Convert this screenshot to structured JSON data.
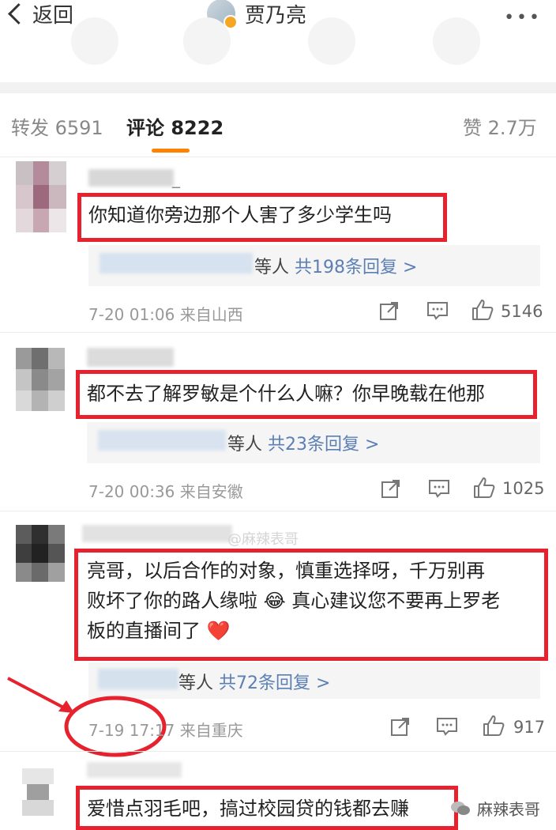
{
  "nav": {
    "back_label": "返回",
    "title": "贾乃亮",
    "more_label": "•••"
  },
  "tabs": [
    {
      "label": "转发 6591"
    },
    {
      "label": "评论 8222"
    },
    {
      "label": "赞 2.7万"
    }
  ],
  "comments": [
    {
      "username_partial": "_",
      "text": "你知道你旁边那个人害了多少学生吗",
      "reply_suffix": "等人",
      "reply_link": "共198条回复 >",
      "time": "7-20 01:06",
      "source": "来自山西",
      "likes": "5146"
    },
    {
      "text": "都不去了解罗敏是个什么人嘛？你早晚载在他那",
      "reply_suffix": "等人",
      "reply_link": "共23条回复 >",
      "time": "7-20 00:36",
      "source": "来自安徽",
      "likes": "1025"
    },
    {
      "text_lines": [
        "亮哥，以后合作的对象，慎重选择呀，千万别再",
        "败坏了你的路人缘啦 😂 真心建议您不要再上罗老",
        "板的直播间了 ❤️"
      ],
      "reply_suffix": "等人",
      "reply_link": "共72条回复 >",
      "time": "7-19 17:17",
      "source": "来自重庆",
      "likes": "917"
    },
    {
      "text": "爱惜点羽毛吧，搞过校园贷的钱都去赚"
    }
  ],
  "watermark": "@麻辣表哥",
  "bottom_watermark": "麻辣表哥",
  "colors": {
    "accent": "#ff8200",
    "highlight_box": "#e5222e",
    "link": "#5b7fb5"
  }
}
